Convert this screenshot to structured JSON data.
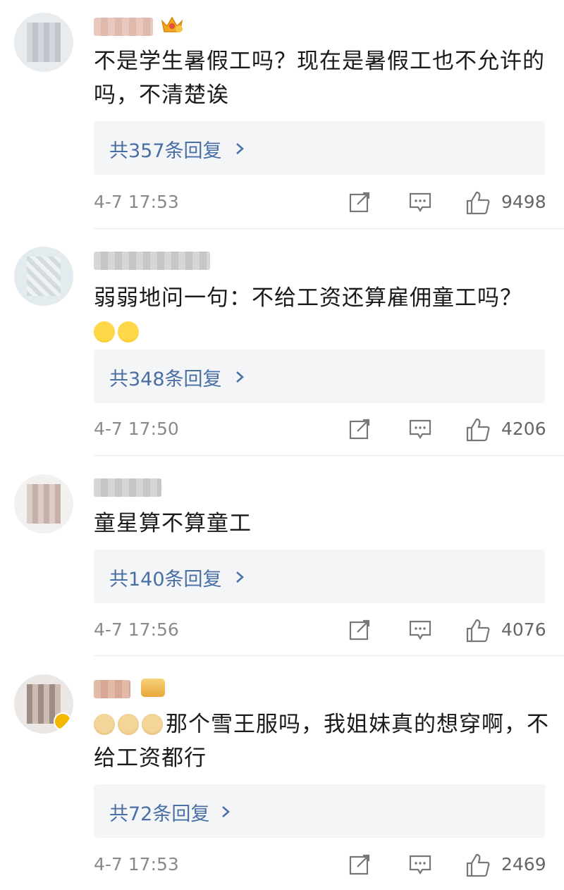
{
  "comments": [
    {
      "text": "不是学生暑假工吗？现在是暑假工也不允许的吗，不清楚诶",
      "reply_label": "共357条回复",
      "time": "4-7 17:53",
      "likes": "9498"
    },
    {
      "text": "弱弱地问一句：不给工资还算雇佣童工吗？",
      "reply_label": "共348条回复",
      "time": "4-7 17:50",
      "likes": "4206"
    },
    {
      "text": "童星算不算童工",
      "reply_label": "共140条回复",
      "time": "4-7 17:56",
      "likes": "4076"
    },
    {
      "text": "那个雪王服吗，我姐妹真的想穿啊，不给工资都行",
      "reply_label": "共72条回复",
      "time": "4-7 17:53",
      "likes": "2469"
    }
  ],
  "icons": [
    "share-icon",
    "comment-icon",
    "like-icon",
    "crown-icon",
    "chevron-right-icon"
  ],
  "colors": {
    "reply_text": "#4a6fa5",
    "reply_bg": "#f4f5f7",
    "meta_text": "#8a8a8a"
  }
}
